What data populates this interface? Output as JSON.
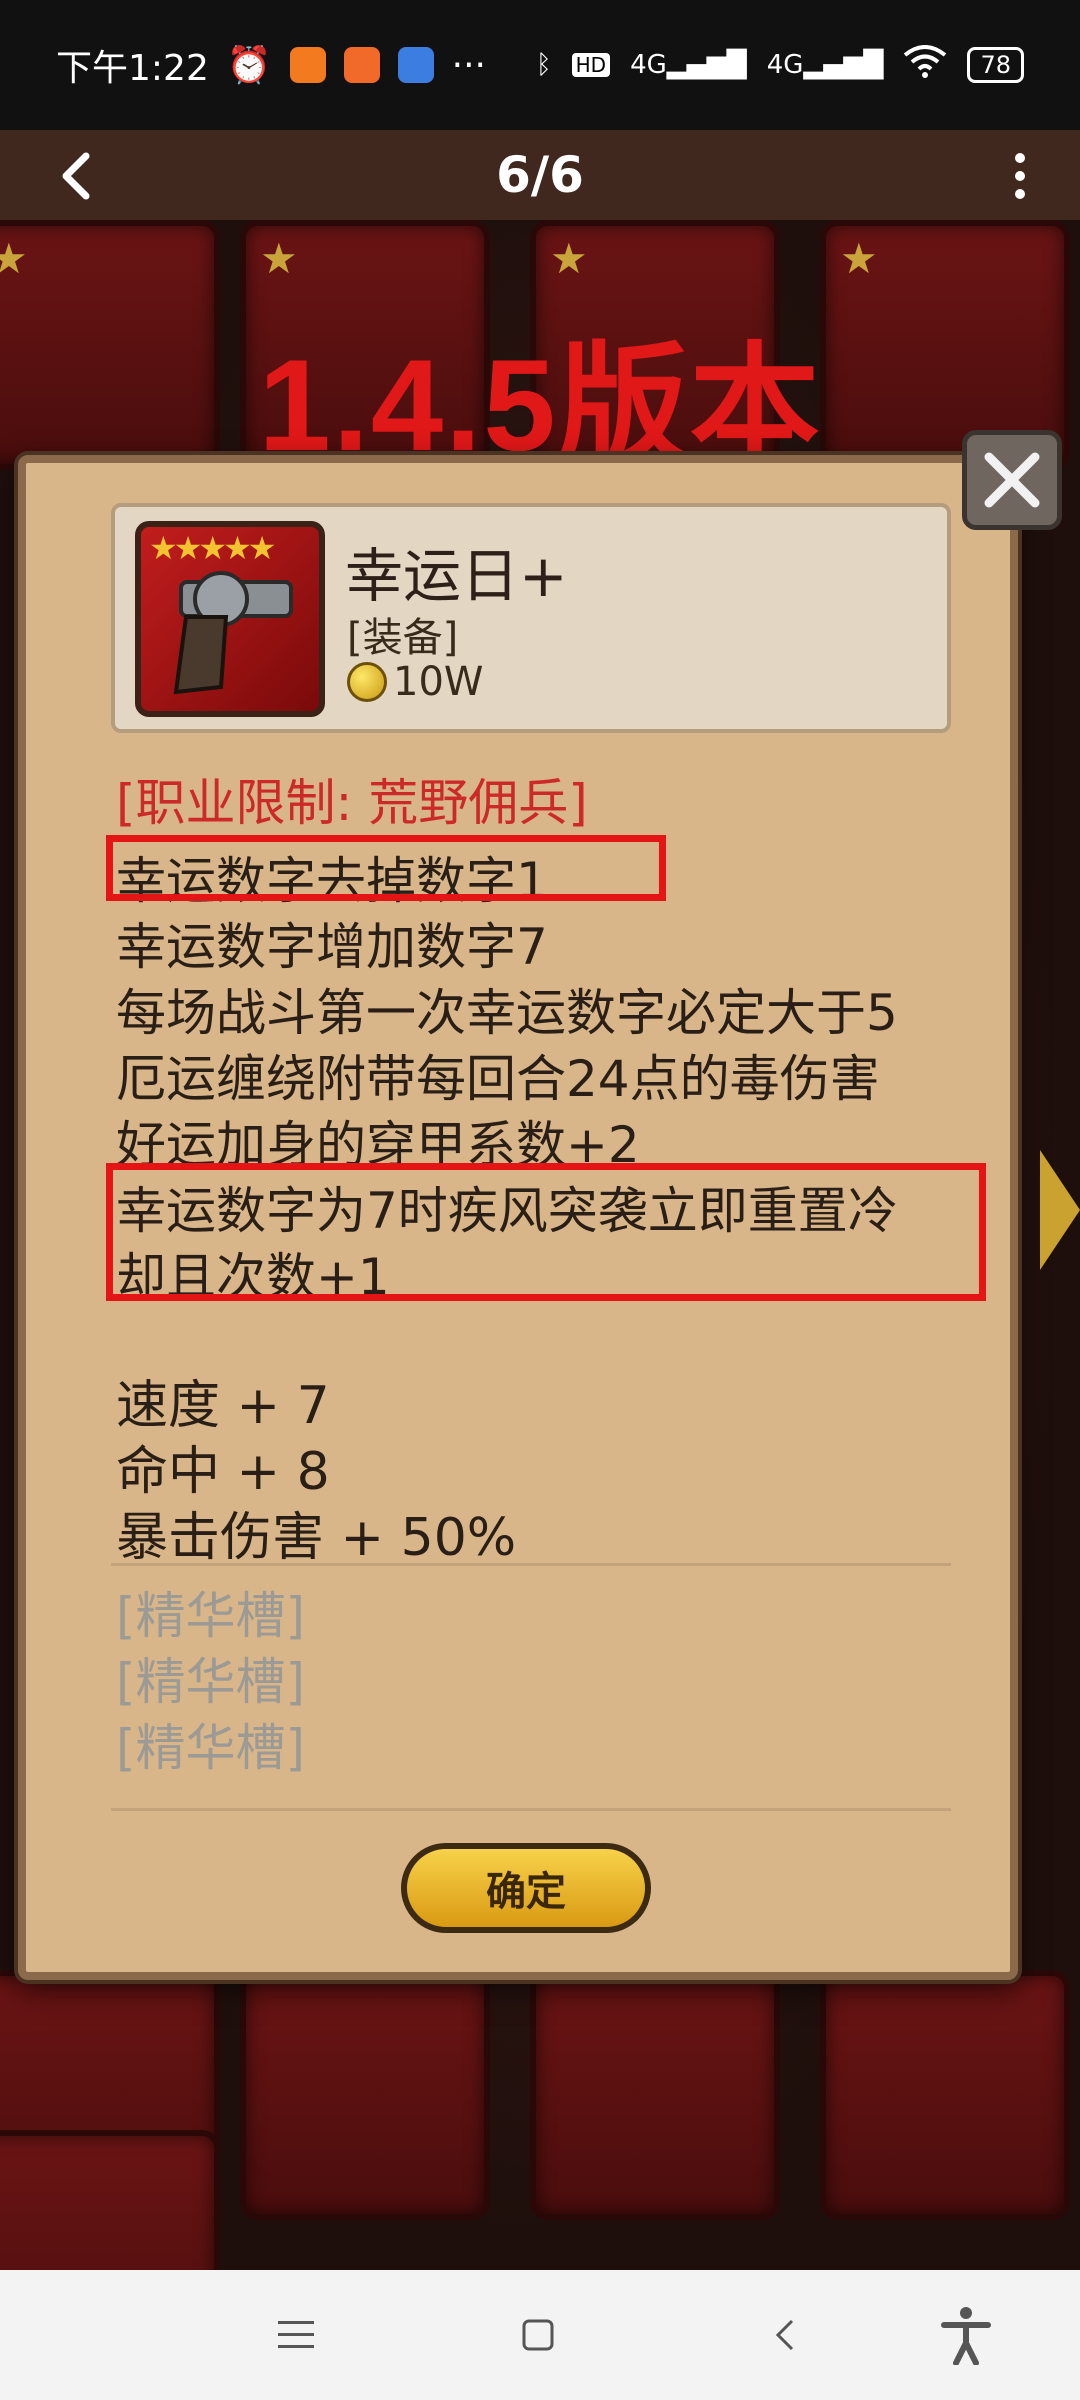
{
  "status_bar": {
    "time": "下午1:22",
    "battery": "78",
    "network_1": "4G",
    "network_2": "4G",
    "more": "···"
  },
  "viewer": {
    "page_counter": "6/6"
  },
  "banner": {
    "text": "1.4.5版本"
  },
  "item": {
    "name": "幸运日+",
    "type": "[装备]",
    "price": "10W",
    "stars": "★★★★★",
    "restriction": "[职业限制: 荒野佣兵]"
  },
  "effects": [
    "幸运数字去掉数字1",
    "幸运数字增加数字7",
    "每场战斗第一次幸运数字必定大于5",
    "厄运缠绕附带每回合24点的毒伤害",
    "好运加身的穿甲系数+2",
    "幸运数字为7时疾风突袭立即重置冷",
    "却且次数+1"
  ],
  "stats": [
    "速度 + 7",
    "命中 + 8",
    "暴击伤害 + 50%"
  ],
  "slots": [
    "[精华槽]",
    "[精华槽]",
    "[精华槽]"
  ],
  "buttons": {
    "confirm": "确定"
  },
  "colors": {
    "highlight": "#e51515",
    "banner": "#e01818",
    "restriction": "#cc2a2a"
  }
}
